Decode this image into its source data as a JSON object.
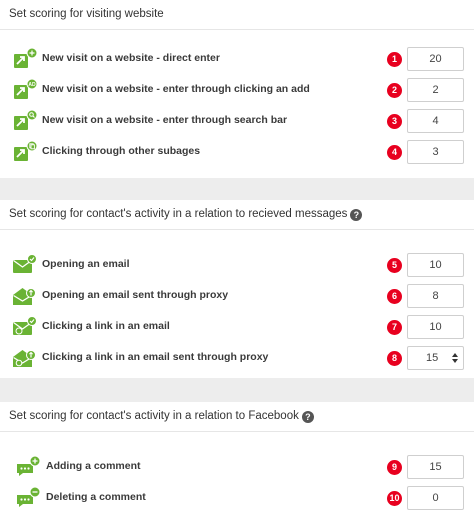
{
  "sections": [
    {
      "title": "Set scoring for visiting website",
      "has_help": false,
      "items": [
        {
          "label": "New visit on a website - direct enter",
          "badge": "1",
          "value": "20",
          "icon": "arrow-plus-icon"
        },
        {
          "label": "New visit on a website - enter through clicking an add",
          "badge": "2",
          "value": "2",
          "icon": "arrow-ad-icon"
        },
        {
          "label": "New visit on a website - enter through search bar",
          "badge": "3",
          "value": "4",
          "icon": "arrow-search-icon"
        },
        {
          "label": "Clicking through other subages",
          "badge": "4",
          "value": "3",
          "icon": "arrow-pages-icon"
        }
      ]
    },
    {
      "title": "Set scoring for contact's activity in a relation to recieved messages",
      "has_help": true,
      "help_glyph": "?",
      "items": [
        {
          "label": "Opening an email",
          "badge": "5",
          "value": "10",
          "icon": "envelope-check-icon"
        },
        {
          "label": "Opening an email sent through proxy",
          "badge": "6",
          "value": "8",
          "icon": "envelope-open-proxy-icon"
        },
        {
          "label": "Clicking a link in an email",
          "badge": "7",
          "value": "10",
          "icon": "envelope-link-icon"
        },
        {
          "label": "Clicking a link in an email sent through proxy",
          "badge": "8",
          "value": "15",
          "icon": "envelope-link-proxy-icon"
        }
      ]
    },
    {
      "title": "Set scoring for contact's activity in a relation to Facebook",
      "has_help": true,
      "help_glyph": "?",
      "items": [
        {
          "label": "Adding a comment",
          "badge": "9",
          "value": "15",
          "icon": "comment-add-icon"
        },
        {
          "label": "Deleting a comment",
          "badge": "10",
          "value": "0",
          "icon": "comment-remove-icon"
        }
      ]
    }
  ],
  "colors": {
    "icon_green": "#6ab334",
    "badge_red": "#e8001f",
    "page_bg": "#ededed"
  }
}
